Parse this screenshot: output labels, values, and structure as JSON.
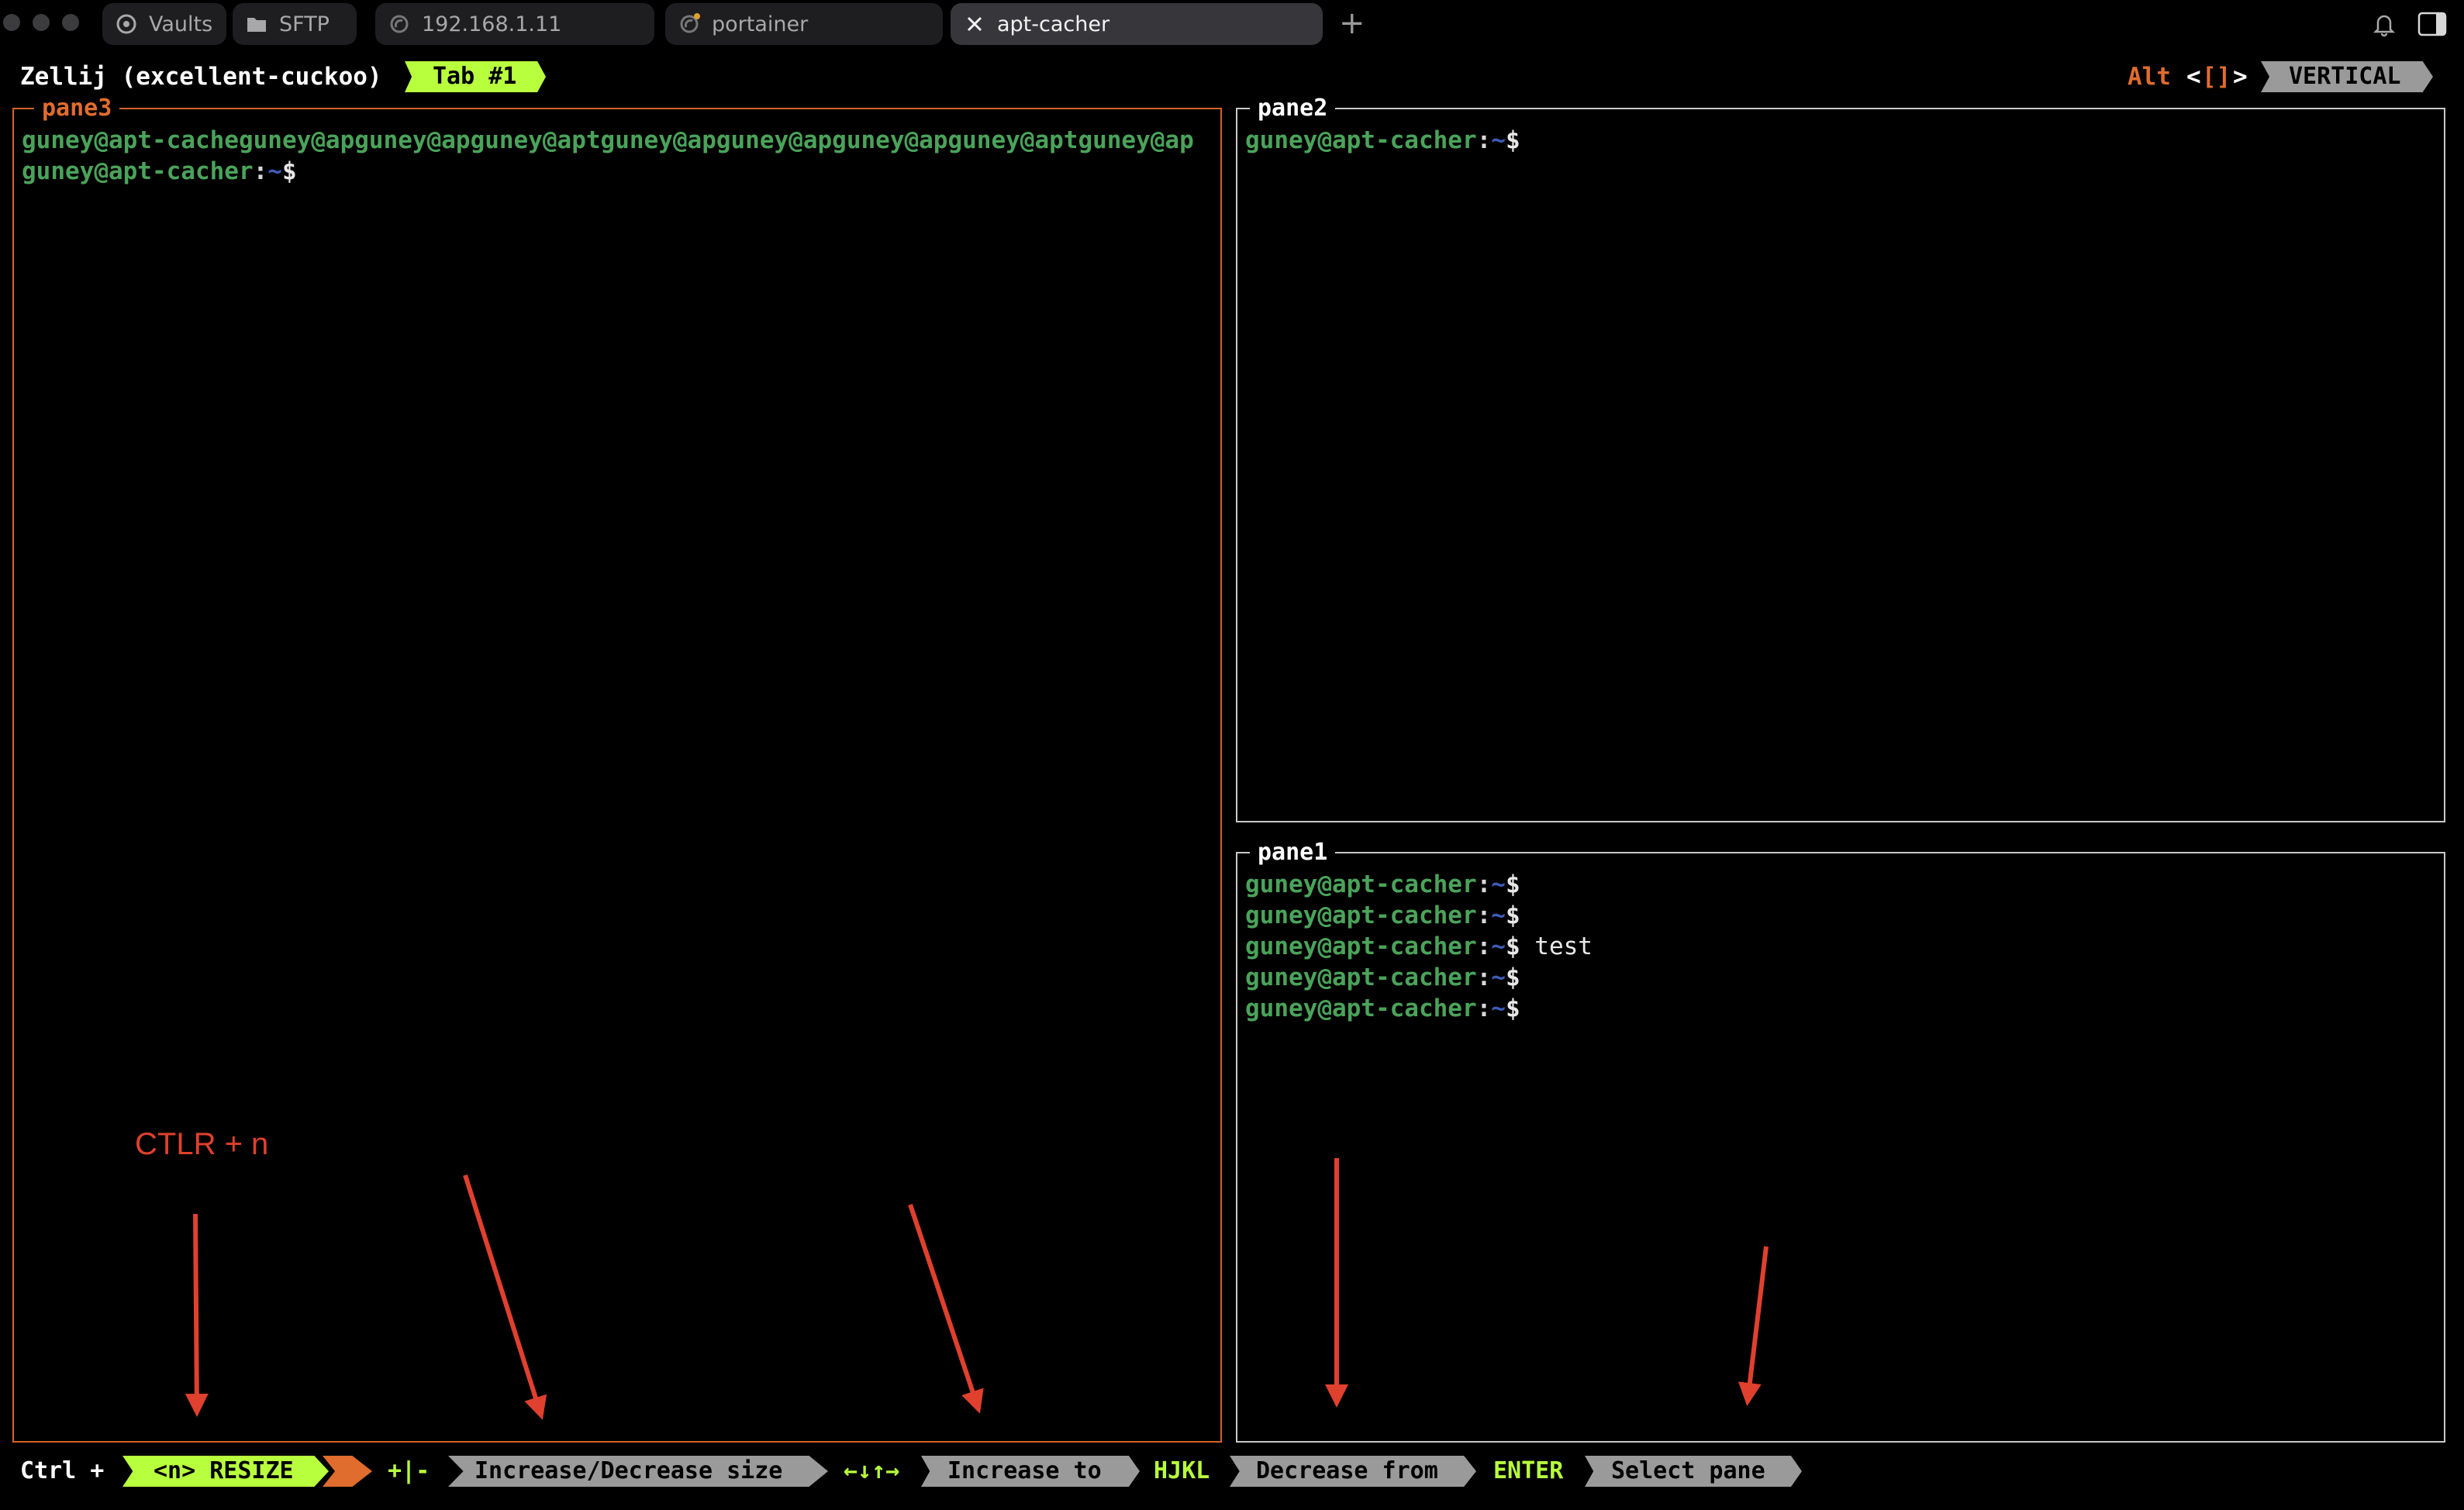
{
  "app_tabs": [
    {
      "label": "Vaults",
      "icon": "vault-icon"
    },
    {
      "label": "SFTP",
      "icon": "folder-icon"
    },
    {
      "label": "192.168.1.11",
      "icon": "host-icon"
    },
    {
      "label": "portainer",
      "icon": "host-icon"
    },
    {
      "label": "apt-cacher",
      "icon": "close-icon",
      "active": true
    }
  ],
  "zellij": {
    "session": "Zellij (excellent-cuckoo)",
    "tab": "Tab #1",
    "alt": "Alt",
    "bracket_left": "<",
    "bracket_mid": "[]",
    "bracket_right": ">",
    "layout": "VERTICAL"
  },
  "panes": {
    "pane3": {
      "title": "pane3",
      "line1": "guney@apt-cacheguney@apguney@apguney@aptguney@apguney@apguney@apguney@aptguney@ap",
      "line2_user": "guney@apt-cacher"
    },
    "pane2": {
      "title": "pane2",
      "line1_user": "guney@apt-cacher"
    },
    "pane1": {
      "title": "pane1",
      "lines": [
        {
          "user": "guney@apt-cacher",
          "cmd": ""
        },
        {
          "user": "guney@apt-cacher",
          "cmd": ""
        },
        {
          "user": "guney@apt-cacher",
          "cmd": " test"
        },
        {
          "user": "guney@apt-cacher",
          "cmd": ""
        },
        {
          "user": "guney@apt-cacher",
          "cmd": ""
        }
      ]
    }
  },
  "prompt": {
    "sep": ":",
    "tilde": "~",
    "dollar": "$"
  },
  "statusbar": {
    "ctrl": "Ctrl +",
    "mode": "<n> RESIZE",
    "plusminus": "+|-",
    "increase_decrease": "Increase/Decrease size",
    "arrows": "←↓↑→",
    "increase_to": "Increase to",
    "hjkl": "HJKL",
    "decrease_from": "Decrease from",
    "enter": "ENTER",
    "select_pane": "Select pane"
  },
  "annotation": {
    "label": "CTLR + n",
    "color": "#e0402e"
  },
  "colors": {
    "accent_green": "#b8ff3d",
    "accent_orange": "#e06c2e",
    "prompt_green": "#4aa35a",
    "segment_gray": "#9a9a9a"
  }
}
